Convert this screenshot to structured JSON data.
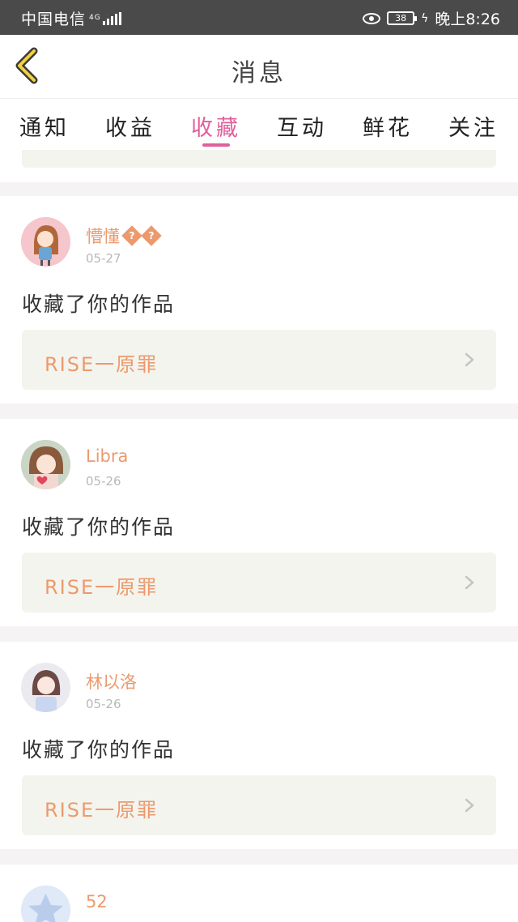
{
  "status_bar": {
    "carrier": "中国电信",
    "network": "4G",
    "battery": "38",
    "time": "晚上8:26"
  },
  "header": {
    "title": "消息"
  },
  "tabs": [
    {
      "label": "通知"
    },
    {
      "label": "收益"
    },
    {
      "label": "收藏"
    },
    {
      "label": "互动"
    },
    {
      "label": "鲜花"
    },
    {
      "label": "关注"
    }
  ],
  "active_tab": "收藏",
  "colors": {
    "accent": "#e0609c",
    "name": "#ec9a6d",
    "card_bg": "#f4f4ee"
  },
  "items": [
    {
      "user": "懵懂",
      "user_suffix": "??",
      "date": "05-27",
      "action": "收藏了你的作品",
      "work": "RISE一原罪"
    },
    {
      "user": "Libra",
      "date": "05-26",
      "action": "收藏了你的作品",
      "work": "RISE一原罪"
    },
    {
      "user": "林以洛",
      "date": "05-26",
      "action": "收藏了你的作品",
      "work": "RISE一原罪"
    },
    {
      "user": "52"
    }
  ]
}
